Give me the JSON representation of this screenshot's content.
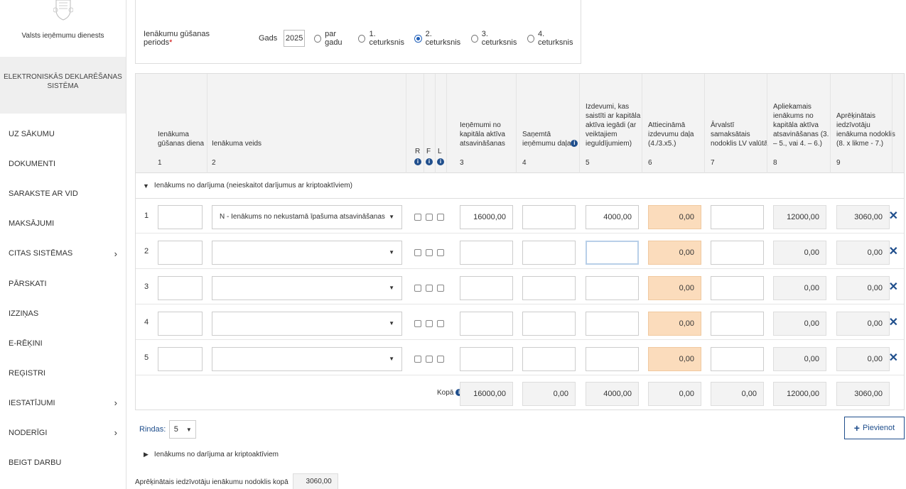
{
  "sidebar": {
    "org_name": "Valsts ieņēmumu dienests",
    "eds_title": "ELEKTRONISKĀS DEKLARĒŠANAS SISTĒMA",
    "items": [
      {
        "label": "UZ SĀKUMU",
        "chevron": false
      },
      {
        "label": "DOKUMENTI",
        "chevron": false
      },
      {
        "label": "SARAKSTE AR VID",
        "chevron": false
      },
      {
        "label": "MAKSĀJUMI",
        "chevron": false
      },
      {
        "label": "CITAS SISTĒMAS",
        "chevron": true
      },
      {
        "label": "PĀRSKATI",
        "chevron": false
      },
      {
        "label": "IZZIŅAS",
        "chevron": false
      },
      {
        "label": "E-RĒĶINI",
        "chevron": false
      },
      {
        "label": "REĢISTRI",
        "chevron": false
      },
      {
        "label": "IESTATĪJUMI",
        "chevron": true
      },
      {
        "label": "NODERĪGI",
        "chevron": true
      },
      {
        "label": "BEIGT DARBU",
        "chevron": false
      }
    ],
    "chevron_glyph": "›"
  },
  "period": {
    "label": "Ienākumu gūšanas periods",
    "required_mark": "*",
    "year_label": "Gads",
    "year_value": "2025",
    "options": [
      {
        "label": "par gadu",
        "selected": false
      },
      {
        "label": "1. ceturksnis",
        "selected": false
      },
      {
        "label": "2. ceturksnis",
        "selected": true
      },
      {
        "label": "3. ceturksnis",
        "selected": false
      },
      {
        "label": "4. ceturksnis",
        "selected": false
      }
    ]
  },
  "table": {
    "columns": [
      {
        "label": "Ienākuma gūšanas diena",
        "num": "1"
      },
      {
        "label": "Ienākuma veids",
        "num": "2"
      },
      {
        "label": "Ieņēmumi no kapitāla aktīva atsavināšanas",
        "num": "3"
      },
      {
        "label": "Saņemtā ieņēmumu daļa",
        "num": "4"
      },
      {
        "label": "Izdevumi, kas saistīti ar kapitāla aktīva iegādi (ar veiktajiem ieguldījumiem)",
        "num": "5"
      },
      {
        "label": "Attiecināmā izdevumu daļa (4./3.x5.)",
        "num": "6"
      },
      {
        "label": "Ārvalstī samaksātais nodoklis LV valūtā",
        "num": "7"
      },
      {
        "label": "Apliekamais ienākums no kapitāla aktīva atsavināšanas (3. – 5., vai 4. – 6.)",
        "num": "8"
      },
      {
        "label": "Aprēķinātais iedzīvotāju ienākuma nodoklis (8. x likme - 7.)",
        "num": "9"
      }
    ],
    "flags": [
      "R",
      "F",
      "L"
    ],
    "info_glyph": "i",
    "group_title": "Ienākums no darījuma (neieskaitot darījumus ar kriptoaktīviem)",
    "rows": [
      {
        "num": "1",
        "type": "N - Ienākums no nekustamā īpašuma atsavināšanas",
        "c3": "16000,00",
        "c4": "",
        "c5": "4000,00",
        "c6": "0,00",
        "c7": "",
        "c8": "12000,00",
        "c9": "3060,00"
      },
      {
        "num": "2",
        "type": "",
        "c3": "",
        "c4": "",
        "c5": "",
        "c6": "0,00",
        "c7": "",
        "c8": "0,00",
        "c9": "0,00"
      },
      {
        "num": "3",
        "type": "",
        "c3": "",
        "c4": "",
        "c5": "",
        "c6": "0,00",
        "c7": "",
        "c8": "0,00",
        "c9": "0,00"
      },
      {
        "num": "4",
        "type": "",
        "c3": "",
        "c4": "",
        "c5": "",
        "c6": "0,00",
        "c7": "",
        "c8": "0,00",
        "c9": "0,00"
      },
      {
        "num": "5",
        "type": "",
        "c3": "",
        "c4": "",
        "c5": "",
        "c6": "0,00",
        "c7": "",
        "c8": "0,00",
        "c9": "0,00"
      }
    ],
    "delete_glyph": "✕",
    "totals": {
      "label": "Kopā",
      "c3": "16000,00",
      "c4": "0,00",
      "c5": "4000,00",
      "c6": "0,00",
      "c7": "0,00",
      "c8": "12000,00",
      "c9": "3060,00"
    }
  },
  "footer": {
    "rows_label": "Rindas:",
    "rows_value": "5",
    "add_label": "Pievienot",
    "crypto_title": "Ienākums no darījuma ar kriptoaktīviem",
    "total_tax_label": "Aprēķinātais iedzīvotāju ienākumu nodoklis kopā",
    "total_tax_value": "3060,00"
  },
  "colors": {
    "accent": "#1f4e8c",
    "computed_field": "#fbdcbc",
    "readonly_field": "#f3f3f3"
  }
}
